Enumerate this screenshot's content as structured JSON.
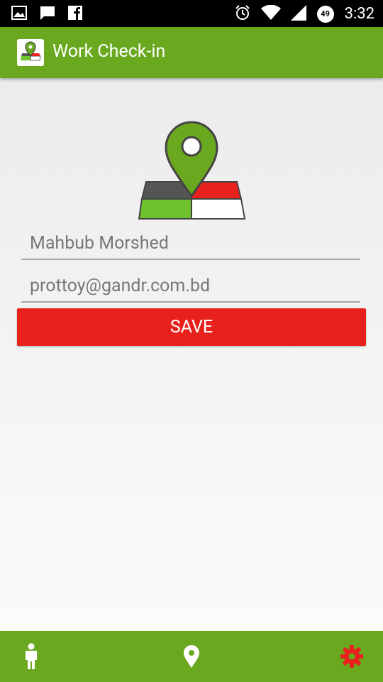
{
  "status_bar": {
    "time": "3:32",
    "battery_level": "49",
    "left_icons": [
      "image-icon",
      "message-icon",
      "facebook-icon"
    ],
    "right_icons": [
      "alarm-icon",
      "wifi-icon",
      "signal-icon",
      "battery-icon"
    ]
  },
  "app_bar": {
    "title": "Work Check-in",
    "icon": "map-pin-logo-icon",
    "color": "#6aa820"
  },
  "form": {
    "name_value": "Mahbub Morshed",
    "email_value": "prottoy@gandr.com.bd",
    "save_label": "SAVE",
    "save_color": "#e8211c"
  },
  "bottom_nav": {
    "items": [
      {
        "icon": "person-icon"
      },
      {
        "icon": "location-pin-icon"
      },
      {
        "icon": "gear-icon",
        "color": "#e8211c"
      }
    ]
  }
}
